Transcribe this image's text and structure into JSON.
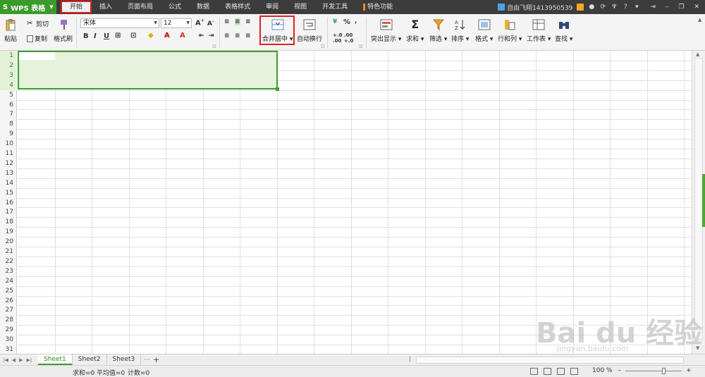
{
  "titlebar": {
    "app_logo": "S",
    "app_name": "WPS 表格",
    "menus": [
      "开始",
      "插入",
      "页面布局",
      "公式",
      "数据",
      "表格样式",
      "审阅",
      "视图",
      "开发工具",
      "特色功能"
    ],
    "user": "自由飞翔1413950539",
    "help": "?"
  },
  "ribbon": {
    "paste": "粘贴",
    "cut": "剪切",
    "copy": "复制",
    "format_painter": "格式刷",
    "font_name": "宋体",
    "font_size": "12",
    "bold": "B",
    "italic": "I",
    "underline": "U",
    "merge_center": "合并居中",
    "wrap_text": "自动换行",
    "percent": "%",
    "conditional": "突出显示",
    "sum": "求和",
    "filter": "筛选",
    "sort": "排序",
    "format": "格式",
    "rows_cols": "行和列",
    "worksheet": "工作表",
    "find": "查找"
  },
  "grid": {
    "rows": [
      "1",
      "2",
      "3",
      "4",
      "5",
      "6",
      "7",
      "8",
      "9",
      "10",
      "11",
      "12",
      "13",
      "14",
      "15",
      "16",
      "17",
      "18",
      "19",
      "20",
      "21",
      "22",
      "23",
      "24",
      "25",
      "26",
      "27",
      "28",
      "29",
      "30",
      "31"
    ],
    "selected_rows": 4,
    "selected_cols": 7
  },
  "sheets": {
    "tabs": [
      "Sheet1",
      "Sheet2",
      "Sheet3"
    ],
    "active": "Sheet1",
    "more": "···",
    "add": "+"
  },
  "status": {
    "sum": "求和=0",
    "average": "平均值=0",
    "count": "计数=0",
    "zoom": "100 %"
  },
  "watermark": {
    "main": "Bai du 经验",
    "sub": "jingyan.baidu.com"
  },
  "colors": {
    "accent_green": "#3e9b2d",
    "highlight_red": "#e02020"
  }
}
